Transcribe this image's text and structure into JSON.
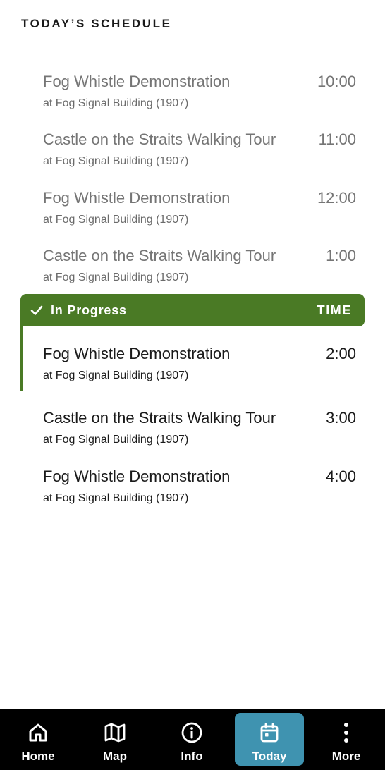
{
  "header": {
    "title": "TODAY’S SCHEDULE"
  },
  "schedule": {
    "past": [
      {
        "title": "Fog Whistle Demonstration",
        "location": "at Fog Signal Building (1907)",
        "time": "10:00"
      },
      {
        "title": "Castle on the Straits Walking Tour",
        "location": "at Fog Signal Building (1907)",
        "time": "11:00"
      },
      {
        "title": "Fog Whistle Demonstration",
        "location": "at Fog Signal Building (1907)",
        "time": "12:00"
      },
      {
        "title": "Castle on the Straits Walking Tour",
        "location": "at Fog Signal Building (1907)",
        "time": "1:00"
      }
    ],
    "in_progress": {
      "label": "In Progress",
      "time_header": "TIME",
      "color": "#4a7a25"
    },
    "current": [
      {
        "title": "Fog Whistle Demonstration",
        "location": "at Fog Signal Building (1907)",
        "time": "2:00"
      }
    ],
    "upcoming": [
      {
        "title": "Castle on the Straits Walking Tour",
        "location": "at Fog Signal Building (1907)",
        "time": "3:00"
      },
      {
        "title": "Fog Whistle Demonstration",
        "location": "at Fog Signal Building (1907)",
        "time": "4:00"
      }
    ]
  },
  "tabbar": {
    "active_color": "#3f93b0",
    "tabs": [
      {
        "label": "Home",
        "icon": "home-icon"
      },
      {
        "label": "Map",
        "icon": "map-icon"
      },
      {
        "label": "Info",
        "icon": "info-icon"
      },
      {
        "label": "Today",
        "icon": "calendar-icon",
        "active": true
      },
      {
        "label": "More",
        "icon": "more-vertical-icon"
      }
    ]
  }
}
